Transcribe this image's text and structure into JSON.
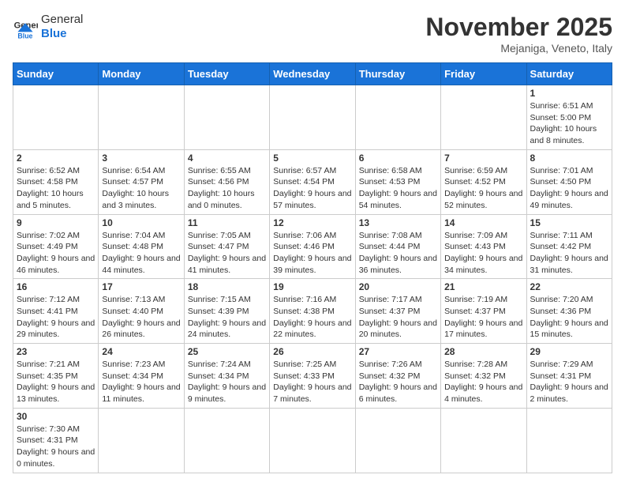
{
  "header": {
    "logo_general": "General",
    "logo_blue": "Blue",
    "month_title": "November 2025",
    "location": "Mejaniga, Veneto, Italy"
  },
  "days_of_week": [
    "Sunday",
    "Monday",
    "Tuesday",
    "Wednesday",
    "Thursday",
    "Friday",
    "Saturday"
  ],
  "weeks": [
    [
      {
        "day": "",
        "info": ""
      },
      {
        "day": "",
        "info": ""
      },
      {
        "day": "",
        "info": ""
      },
      {
        "day": "",
        "info": ""
      },
      {
        "day": "",
        "info": ""
      },
      {
        "day": "",
        "info": ""
      },
      {
        "day": "1",
        "info": "Sunrise: 6:51 AM\nSunset: 5:00 PM\nDaylight: 10 hours and 8 minutes."
      }
    ],
    [
      {
        "day": "2",
        "info": "Sunrise: 6:52 AM\nSunset: 4:58 PM\nDaylight: 10 hours and 5 minutes."
      },
      {
        "day": "3",
        "info": "Sunrise: 6:54 AM\nSunset: 4:57 PM\nDaylight: 10 hours and 3 minutes."
      },
      {
        "day": "4",
        "info": "Sunrise: 6:55 AM\nSunset: 4:56 PM\nDaylight: 10 hours and 0 minutes."
      },
      {
        "day": "5",
        "info": "Sunrise: 6:57 AM\nSunset: 4:54 PM\nDaylight: 9 hours and 57 minutes."
      },
      {
        "day": "6",
        "info": "Sunrise: 6:58 AM\nSunset: 4:53 PM\nDaylight: 9 hours and 54 minutes."
      },
      {
        "day": "7",
        "info": "Sunrise: 6:59 AM\nSunset: 4:52 PM\nDaylight: 9 hours and 52 minutes."
      },
      {
        "day": "8",
        "info": "Sunrise: 7:01 AM\nSunset: 4:50 PM\nDaylight: 9 hours and 49 minutes."
      }
    ],
    [
      {
        "day": "9",
        "info": "Sunrise: 7:02 AM\nSunset: 4:49 PM\nDaylight: 9 hours and 46 minutes."
      },
      {
        "day": "10",
        "info": "Sunrise: 7:04 AM\nSunset: 4:48 PM\nDaylight: 9 hours and 44 minutes."
      },
      {
        "day": "11",
        "info": "Sunrise: 7:05 AM\nSunset: 4:47 PM\nDaylight: 9 hours and 41 minutes."
      },
      {
        "day": "12",
        "info": "Sunrise: 7:06 AM\nSunset: 4:46 PM\nDaylight: 9 hours and 39 minutes."
      },
      {
        "day": "13",
        "info": "Sunrise: 7:08 AM\nSunset: 4:44 PM\nDaylight: 9 hours and 36 minutes."
      },
      {
        "day": "14",
        "info": "Sunrise: 7:09 AM\nSunset: 4:43 PM\nDaylight: 9 hours and 34 minutes."
      },
      {
        "day": "15",
        "info": "Sunrise: 7:11 AM\nSunset: 4:42 PM\nDaylight: 9 hours and 31 minutes."
      }
    ],
    [
      {
        "day": "16",
        "info": "Sunrise: 7:12 AM\nSunset: 4:41 PM\nDaylight: 9 hours and 29 minutes."
      },
      {
        "day": "17",
        "info": "Sunrise: 7:13 AM\nSunset: 4:40 PM\nDaylight: 9 hours and 26 minutes."
      },
      {
        "day": "18",
        "info": "Sunrise: 7:15 AM\nSunset: 4:39 PM\nDaylight: 9 hours and 24 minutes."
      },
      {
        "day": "19",
        "info": "Sunrise: 7:16 AM\nSunset: 4:38 PM\nDaylight: 9 hours and 22 minutes."
      },
      {
        "day": "20",
        "info": "Sunrise: 7:17 AM\nSunset: 4:37 PM\nDaylight: 9 hours and 20 minutes."
      },
      {
        "day": "21",
        "info": "Sunrise: 7:19 AM\nSunset: 4:37 PM\nDaylight: 9 hours and 17 minutes."
      },
      {
        "day": "22",
        "info": "Sunrise: 7:20 AM\nSunset: 4:36 PM\nDaylight: 9 hours and 15 minutes."
      }
    ],
    [
      {
        "day": "23",
        "info": "Sunrise: 7:21 AM\nSunset: 4:35 PM\nDaylight: 9 hours and 13 minutes."
      },
      {
        "day": "24",
        "info": "Sunrise: 7:23 AM\nSunset: 4:34 PM\nDaylight: 9 hours and 11 minutes."
      },
      {
        "day": "25",
        "info": "Sunrise: 7:24 AM\nSunset: 4:34 PM\nDaylight: 9 hours and 9 minutes."
      },
      {
        "day": "26",
        "info": "Sunrise: 7:25 AM\nSunset: 4:33 PM\nDaylight: 9 hours and 7 minutes."
      },
      {
        "day": "27",
        "info": "Sunrise: 7:26 AM\nSunset: 4:32 PM\nDaylight: 9 hours and 6 minutes."
      },
      {
        "day": "28",
        "info": "Sunrise: 7:28 AM\nSunset: 4:32 PM\nDaylight: 9 hours and 4 minutes."
      },
      {
        "day": "29",
        "info": "Sunrise: 7:29 AM\nSunset: 4:31 PM\nDaylight: 9 hours and 2 minutes."
      }
    ],
    [
      {
        "day": "30",
        "info": "Sunrise: 7:30 AM\nSunset: 4:31 PM\nDaylight: 9 hours and 0 minutes."
      },
      {
        "day": "",
        "info": ""
      },
      {
        "day": "",
        "info": ""
      },
      {
        "day": "",
        "info": ""
      },
      {
        "day": "",
        "info": ""
      },
      {
        "day": "",
        "info": ""
      },
      {
        "day": "",
        "info": ""
      }
    ]
  ]
}
